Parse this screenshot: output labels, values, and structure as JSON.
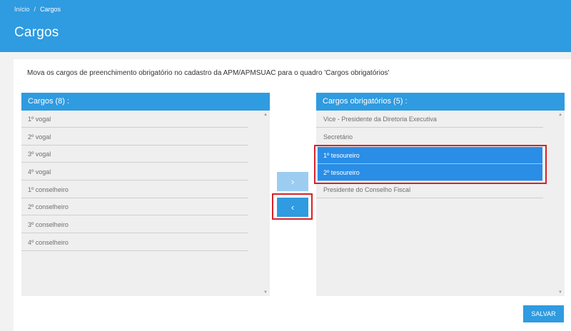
{
  "breadcrumb": {
    "home": "Início",
    "separator": "/",
    "current": "Cargos"
  },
  "page_title": "Cargos",
  "instruction": "Mova os cargos de preenchimento obrigatório no cadastro da APM/APMSUAC para o quadro 'Cargos obrigatórios'",
  "left_panel": {
    "title": "Cargos (8) :",
    "items": [
      "1º vogal",
      "2º vogal",
      "3º vogal",
      "4º vogal",
      "1º conselheiro",
      "2º conselheiro",
      "3º conselheiro",
      "4º conselheiro"
    ]
  },
  "right_panel": {
    "title": "Cargos obrigatórios (5) :",
    "items": [
      "Vice - Presidente da Diretoria Executiva",
      "Secretário",
      "1º tesoureiro",
      "2º tesoureiro",
      "Presidente do Conselho Fiscal"
    ],
    "selected": [
      "1º tesoureiro",
      "2º tesoureiro"
    ]
  },
  "buttons": {
    "move_right": "›",
    "move_left": "‹",
    "save": "SALVAR"
  },
  "icons": {
    "scroll_up": "▲",
    "scroll_down": "▼"
  },
  "colors": {
    "primary": "#2f9be0",
    "selected": "#2a8de6",
    "highlight": "#d9212a",
    "disabled": "#9ccdf1"
  }
}
